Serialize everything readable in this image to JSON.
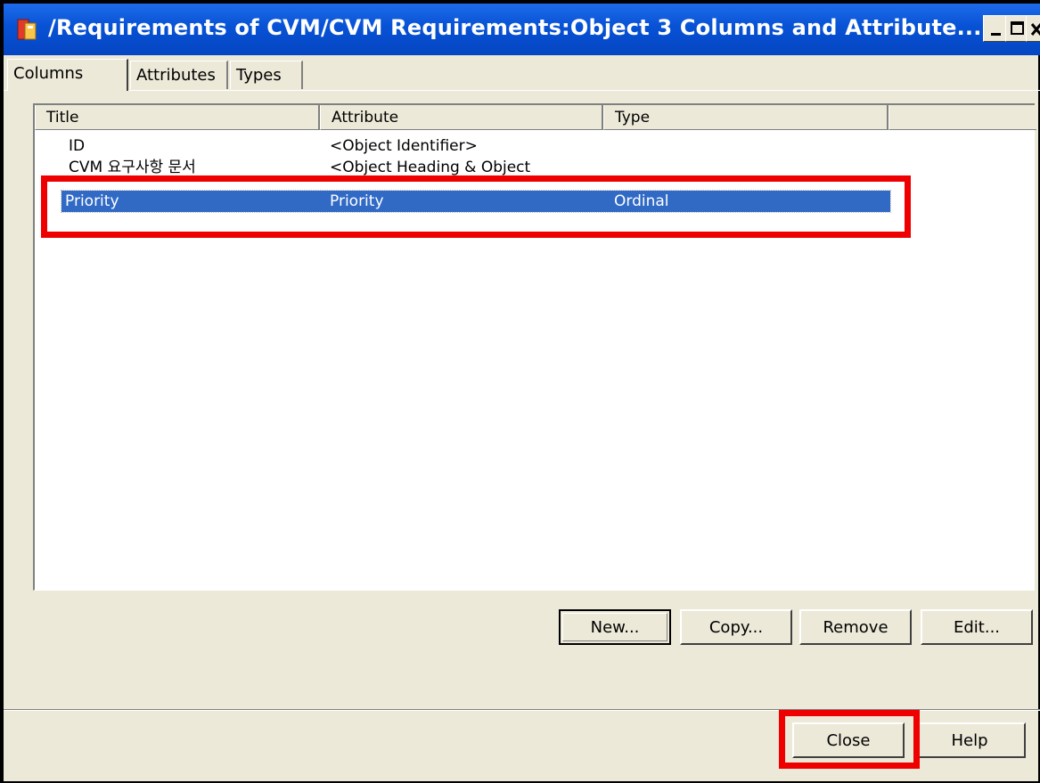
{
  "window": {
    "title": "/Requirements of CVM/CVM Requirements:Object 3 Columns and Attribute..."
  },
  "tabs": [
    {
      "label": "Columns"
    },
    {
      "label": "Attributes"
    },
    {
      "label": "Types"
    }
  ],
  "list": {
    "headers": [
      "Title",
      "Attribute",
      "Type",
      ""
    ],
    "rows": [
      {
        "title": "ID",
        "attribute": "<Object Identifier>",
        "type": ""
      },
      {
        "title": "CVM 요구사항 문서",
        "attribute": "<Object Heading & Object",
        "type": ""
      },
      {
        "title": "Priority",
        "attribute": "Priority",
        "type": "Ordinal"
      }
    ],
    "selected_row": 2
  },
  "buttons": {
    "new": "New...",
    "copy": "Copy...",
    "remove": "Remove",
    "edit": "Edit...",
    "close": "Close",
    "help": "Help"
  },
  "colors": {
    "titlebar": "#0752d4",
    "selection": "#316ac5",
    "highlight": "#ee0000",
    "dialog_bg": "#ece9d8"
  }
}
